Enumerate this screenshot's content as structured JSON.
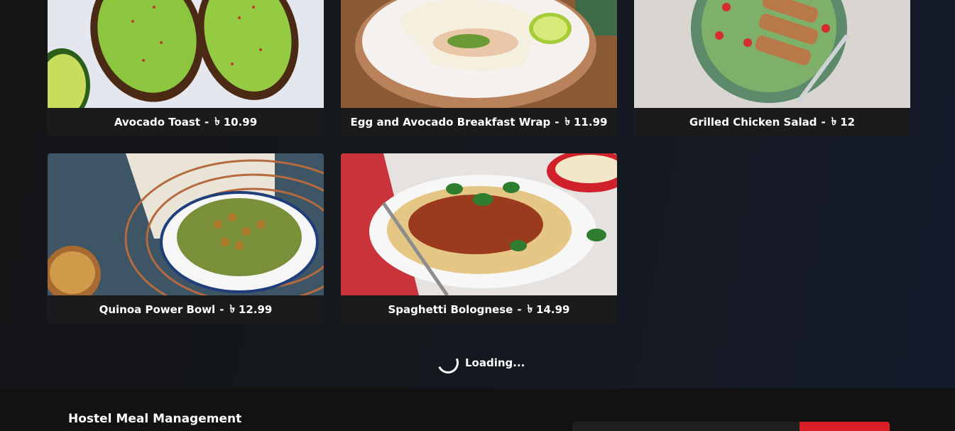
{
  "meals": [
    {
      "name": "Avocado Toast",
      "separator": "-",
      "currency": "৳",
      "price": "10.99",
      "image": "avocado-toast-photo"
    },
    {
      "name": "Egg and Avocado Breakfast Wrap",
      "separator": "-",
      "currency": "৳",
      "price": "11.99",
      "image": "breakfast-wrap-photo"
    },
    {
      "name": "Grilled Chicken Salad",
      "separator": "-",
      "currency": "৳",
      "price": "12",
      "image": "chicken-salad-photo"
    },
    {
      "name": "Quinoa Power Bowl",
      "separator": "-",
      "currency": "৳",
      "price": "12.99",
      "image": "quinoa-bowl-photo"
    },
    {
      "name": "Spaghetti Bolognese",
      "separator": "-",
      "currency": "৳",
      "price": "14.99",
      "image": "spaghetti-photo"
    }
  ],
  "loading": {
    "text": "Loading...",
    "icon": "spinner-icon"
  },
  "footer": {
    "title": "Hostel Meal Management"
  },
  "colors": {
    "background": "#121417",
    "card": "#1a1b1c",
    "accent": "#d91e25"
  }
}
